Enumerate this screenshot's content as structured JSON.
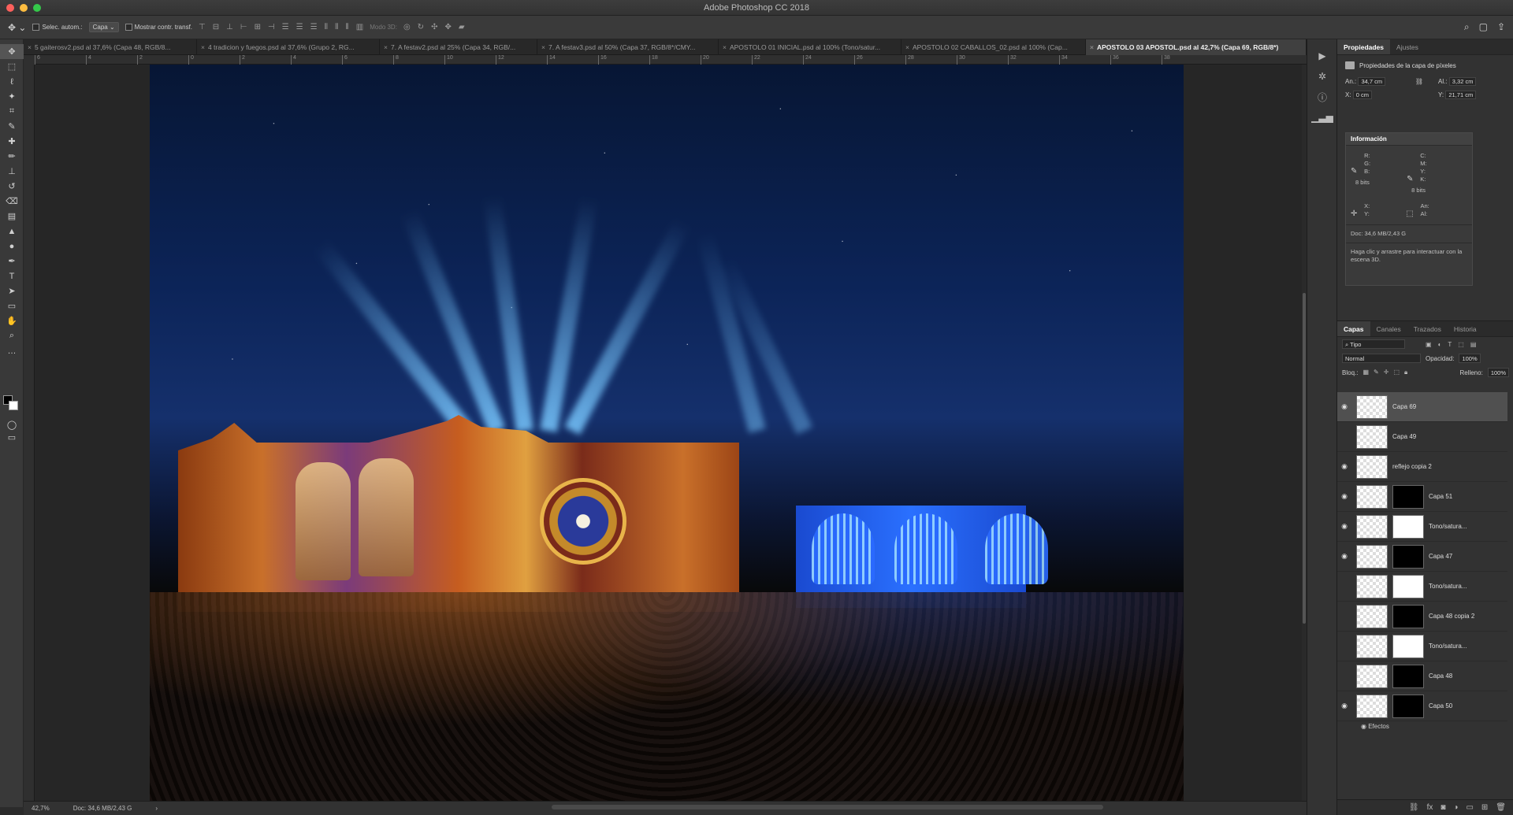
{
  "window": {
    "title": "Adobe Photoshop CC 2018"
  },
  "options": {
    "auto_select_label": "Selec. autom.:",
    "auto_select_value": "Capa",
    "show_transform_label": "Mostrar contr. transf.",
    "mode3d_label": "Modo 3D:"
  },
  "tabs": [
    {
      "label": "5 gaiterosv2.psd al 37,6% (Capa 48, RGB/8..."
    },
    {
      "label": "4 tradicion y fuegos.psd al 37,6% (Grupo 2, RG..."
    },
    {
      "label": "7. A festav2.psd al 25% (Capa 34, RGB/..."
    },
    {
      "label": "7. A festav3.psd al 50% (Capa 37, RGB/8*/CMY..."
    },
    {
      "label": "APOSTOLO 01 INICIAL.psd al 100% (Tono/satur..."
    },
    {
      "label": "APOSTOLO 02 CABALLOS_02.psd al 100% (Cap..."
    },
    {
      "label": "APOSTOLO 03 APOSTOL.psd al 42,7% (Capa 69, RGB/8*)"
    }
  ],
  "ruler": [
    "6",
    "4",
    "2",
    "0",
    "2",
    "4",
    "6",
    "8",
    "10",
    "12",
    "14",
    "16",
    "18",
    "20",
    "22",
    "24",
    "26",
    "28",
    "30",
    "32",
    "34",
    "36",
    "38"
  ],
  "status": {
    "zoom": "42,7%",
    "doc": "Doc: 34,6 MB/2,43 G"
  },
  "properties": {
    "tab_active": "Propiedades",
    "tab2": "Ajustes",
    "heading": "Propiedades de la capa de píxeles",
    "w_label": "An.:",
    "w_value": "34,7 cm",
    "h_label": "Al.:",
    "h_value": "3,32 cm",
    "x_label": "X:",
    "x_value": "0 cm",
    "y_label": "Y:",
    "y_value": "21,71 cm"
  },
  "info": {
    "title": "Información",
    "rgb": "R:\nG:\nB:",
    "cmyk": "C:\nM:\nY:\nK:",
    "bits1": "8 bits",
    "bits2": "8 bits",
    "xy": "X:\nY:",
    "wh": "An:\nAl:",
    "doc": "Doc: 34,6 MB/2,43 G",
    "hint": "Haga clic y arrastre para interactuar con la escena 3D."
  },
  "layers_panel": {
    "tabs": [
      "Capas",
      "Canales",
      "Trazados",
      "Historia"
    ],
    "filter": "Tipo",
    "blend": "Normal",
    "opacity_label": "Opacidad:",
    "opacity": "100%",
    "lock_label": "Bloq.:",
    "fill_label": "Relleno:",
    "fill": "100%",
    "layers": [
      {
        "name": "Capa 69",
        "active": true,
        "visible": true,
        "mask": "none"
      },
      {
        "name": "Capa 49",
        "active": false,
        "visible": false,
        "mask": "none"
      },
      {
        "name": "reflejo copia 2",
        "active": false,
        "visible": true,
        "mask": "none"
      },
      {
        "name": "Capa 51",
        "active": false,
        "visible": true,
        "mask": "dark"
      },
      {
        "name": "Tono/satura...",
        "active": false,
        "visible": true,
        "mask": "light"
      },
      {
        "name": "Capa 47",
        "active": false,
        "visible": true,
        "mask": "dark"
      },
      {
        "name": "Tono/satura...",
        "active": false,
        "visible": false,
        "mask": "light"
      },
      {
        "name": "Capa 48 copia 2",
        "active": false,
        "visible": false,
        "mask": "dark"
      },
      {
        "name": "Tono/satura...",
        "active": false,
        "visible": false,
        "mask": "light"
      },
      {
        "name": "Capa 48",
        "active": false,
        "visible": false,
        "mask": "dark"
      },
      {
        "name": "Capa 50",
        "active": false,
        "visible": true,
        "mask": "dark"
      }
    ],
    "effects_label": "Efectos"
  }
}
